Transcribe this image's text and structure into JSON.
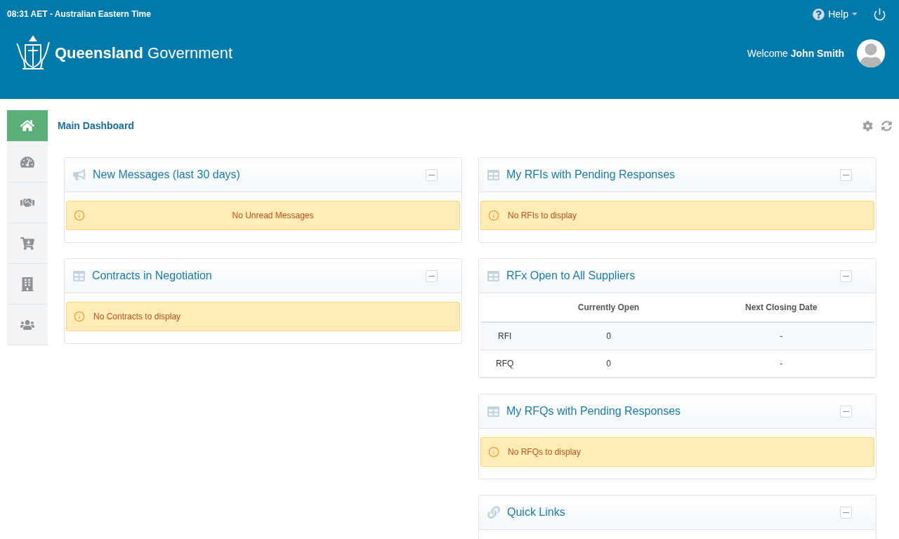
{
  "top_bar": {
    "time": "08:31 AET - Australian Eastern Time",
    "help": "Help"
  },
  "brand": {
    "bold": "Queensland",
    "light": "Government"
  },
  "user": {
    "welcome": "Welcome **John Smith**"
  },
  "sidebar": {
    "items": [
      {
        "selected": true
      },
      {
        "selected": false
      },
      {
        "selected": false
      },
      {
        "selected": false
      },
      {
        "selected": false
      },
      {
        "selected": false
      }
    ]
  },
  "page": {
    "title": "Main Dashboard"
  },
  "columns": [
    {
      "widgets": [
        {
          "kind": "alert",
          "title": "New Messages (last 30 days)",
          "message": "No Unread Messages",
          "centered": true
        },
        {
          "kind": "alert",
          "title": "Contracts in Negotiation",
          "message": "No Contracts to display",
          "centered": false
        }
      ]
    },
    {
      "widgets": [
        {
          "kind": "alert",
          "title": "My RFIs with Pending Responses",
          "message": "No RFIs to display",
          "centered": false
        },
        {
          "kind": "table",
          "title": "RFx Open to All Suppliers",
          "columns": [
            "",
            "Currently Open",
            "Next Closing Date"
          ],
          "rows": [
            [
              "RFI",
              "0",
              "-"
            ],
            [
              "RFQ",
              "0",
              "-"
            ]
          ]
        },
        {
          "kind": "alert",
          "title": "My RFQs with Pending Responses",
          "message": "No RFQs to display",
          "centered": false
        },
        {
          "kind": "empty",
          "title": "Quick Links"
        }
      ]
    }
  ]
}
